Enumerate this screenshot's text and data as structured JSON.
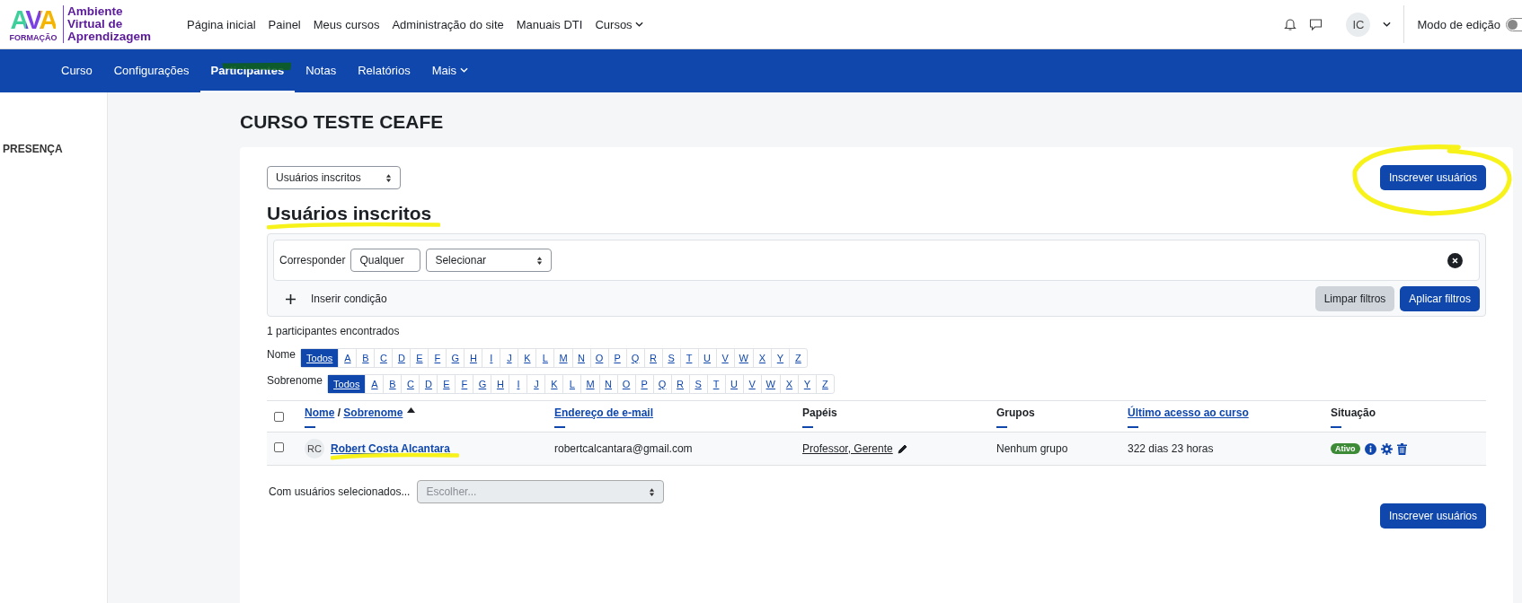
{
  "logo": {
    "letters": "AVA",
    "sub": "FORMAÇÃO",
    "title_lines": [
      "Ambiente",
      "Virtual de",
      "Aprendizagem"
    ]
  },
  "top_nav": [
    {
      "label": "Página inicial",
      "dropdown": false
    },
    {
      "label": "Painel",
      "dropdown": false
    },
    {
      "label": "Meus cursos",
      "dropdown": false
    },
    {
      "label": "Administração do site",
      "dropdown": false
    },
    {
      "label": "Manuais DTI",
      "dropdown": false
    },
    {
      "label": "Cursos",
      "dropdown": true
    }
  ],
  "user": {
    "initials": "IC",
    "edit_mode_label": "Modo de edição",
    "edit_mode_on": false
  },
  "course_tabs": [
    {
      "label": "Curso",
      "selected": false,
      "dropdown": false,
      "highlighted": false
    },
    {
      "label": "Configurações",
      "selected": false,
      "dropdown": false,
      "highlighted": false
    },
    {
      "label": "Participantes",
      "selected": true,
      "dropdown": false,
      "highlighted": true
    },
    {
      "label": "Notas",
      "selected": false,
      "dropdown": false,
      "highlighted": false
    },
    {
      "label": "Relatórios",
      "selected": false,
      "dropdown": false,
      "highlighted": false
    },
    {
      "label": "Mais",
      "selected": false,
      "dropdown": true,
      "highlighted": false
    }
  ],
  "sidebar": {
    "items": [
      "PRESENÇA"
    ]
  },
  "course_title": "CURSO TESTE CEAFE",
  "view_select": {
    "value": "Usuários inscritos"
  },
  "enrol_button_top": {
    "label": "Inscrever usuários",
    "circled": true
  },
  "heading": {
    "text": "Usuários inscritos",
    "underlined": true
  },
  "filters": {
    "match_label": "Corresponder",
    "match_value": "Qualquer",
    "condition_value": "Selecionar",
    "add_condition": "Inserir condição",
    "clear": "Limpar filtros",
    "apply": "Aplicar filtros"
  },
  "count_text": "1 participantes encontrados",
  "initials_bars": [
    {
      "label": "Nome",
      "letters": [
        {
          "text": "Todos",
          "selected": true
        },
        {
          "text": "A",
          "selected": false
        },
        {
          "text": "B",
          "selected": false
        },
        {
          "text": "C",
          "selected": false
        },
        {
          "text": "D",
          "selected": false
        },
        {
          "text": "E",
          "selected": false
        },
        {
          "text": "F",
          "selected": false
        },
        {
          "text": "G",
          "selected": false
        },
        {
          "text": "H",
          "selected": false
        },
        {
          "text": "I",
          "selected": false
        },
        {
          "text": "J",
          "selected": false
        },
        {
          "text": "K",
          "selected": false
        },
        {
          "text": "L",
          "selected": false
        },
        {
          "text": "M",
          "selected": false
        },
        {
          "text": "N",
          "selected": false
        },
        {
          "text": "O",
          "selected": false
        },
        {
          "text": "P",
          "selected": false
        },
        {
          "text": "Q",
          "selected": false
        },
        {
          "text": "R",
          "selected": false
        },
        {
          "text": "S",
          "selected": false
        },
        {
          "text": "T",
          "selected": false
        },
        {
          "text": "U",
          "selected": false
        },
        {
          "text": "V",
          "selected": false
        },
        {
          "text": "W",
          "selected": false
        },
        {
          "text": "X",
          "selected": false
        },
        {
          "text": "Y",
          "selected": false
        },
        {
          "text": "Z",
          "selected": false
        }
      ]
    },
    {
      "label": "Sobrenome",
      "letters": [
        {
          "text": "Todos",
          "selected": true
        },
        {
          "text": "A",
          "selected": false
        },
        {
          "text": "B",
          "selected": false
        },
        {
          "text": "C",
          "selected": false
        },
        {
          "text": "D",
          "selected": false
        },
        {
          "text": "E",
          "selected": false
        },
        {
          "text": "F",
          "selected": false
        },
        {
          "text": "G",
          "selected": false
        },
        {
          "text": "H",
          "selected": false
        },
        {
          "text": "I",
          "selected": false
        },
        {
          "text": "J",
          "selected": false
        },
        {
          "text": "K",
          "selected": false
        },
        {
          "text": "L",
          "selected": false
        },
        {
          "text": "M",
          "selected": false
        },
        {
          "text": "N",
          "selected": false
        },
        {
          "text": "O",
          "selected": false
        },
        {
          "text": "P",
          "selected": false
        },
        {
          "text": "Q",
          "selected": false
        },
        {
          "text": "R",
          "selected": false
        },
        {
          "text": "S",
          "selected": false
        },
        {
          "text": "T",
          "selected": false
        },
        {
          "text": "U",
          "selected": false
        },
        {
          "text": "V",
          "selected": false
        },
        {
          "text": "W",
          "selected": false
        },
        {
          "text": "X",
          "selected": false
        },
        {
          "text": "Y",
          "selected": false
        },
        {
          "text": "Z",
          "selected": false
        }
      ]
    }
  ],
  "table": {
    "all_checked": false,
    "columns": [
      {
        "parts": [
          {
            "text": "Nome",
            "link": true
          },
          {
            "text": " / ",
            "link": false
          },
          {
            "text": "Sobrenome",
            "link": true
          }
        ],
        "sorted": true
      },
      {
        "parts": [
          {
            "text": "Endereço de e-mail",
            "link": true
          }
        ],
        "sorted": false
      },
      {
        "parts": [
          {
            "text": "Papéis",
            "link": false
          }
        ],
        "sorted": false
      },
      {
        "parts": [
          {
            "text": "Grupos",
            "link": false
          }
        ],
        "sorted": false
      },
      {
        "parts": [
          {
            "text": "Último acesso ao curso",
            "link": true
          }
        ],
        "sorted": false
      },
      {
        "parts": [
          {
            "text": "Situação",
            "link": false
          }
        ],
        "sorted": false
      }
    ],
    "rows": [
      {
        "checked": false,
        "initials": "RC",
        "name": "Robert Costa Alcantara",
        "name_underlined": true,
        "email": "robertcalcantara@gmail.com",
        "roles": "Professor, Gerente",
        "groups": "Nenhum grupo",
        "last_access": "322 dias 23 horas",
        "status": "Ativo"
      }
    ]
  },
  "bulk": {
    "label": "Com usuários selecionados...",
    "placeholder": "Escolher..."
  },
  "enrol_button_bottom": {
    "label": "Inscrever usuários"
  }
}
